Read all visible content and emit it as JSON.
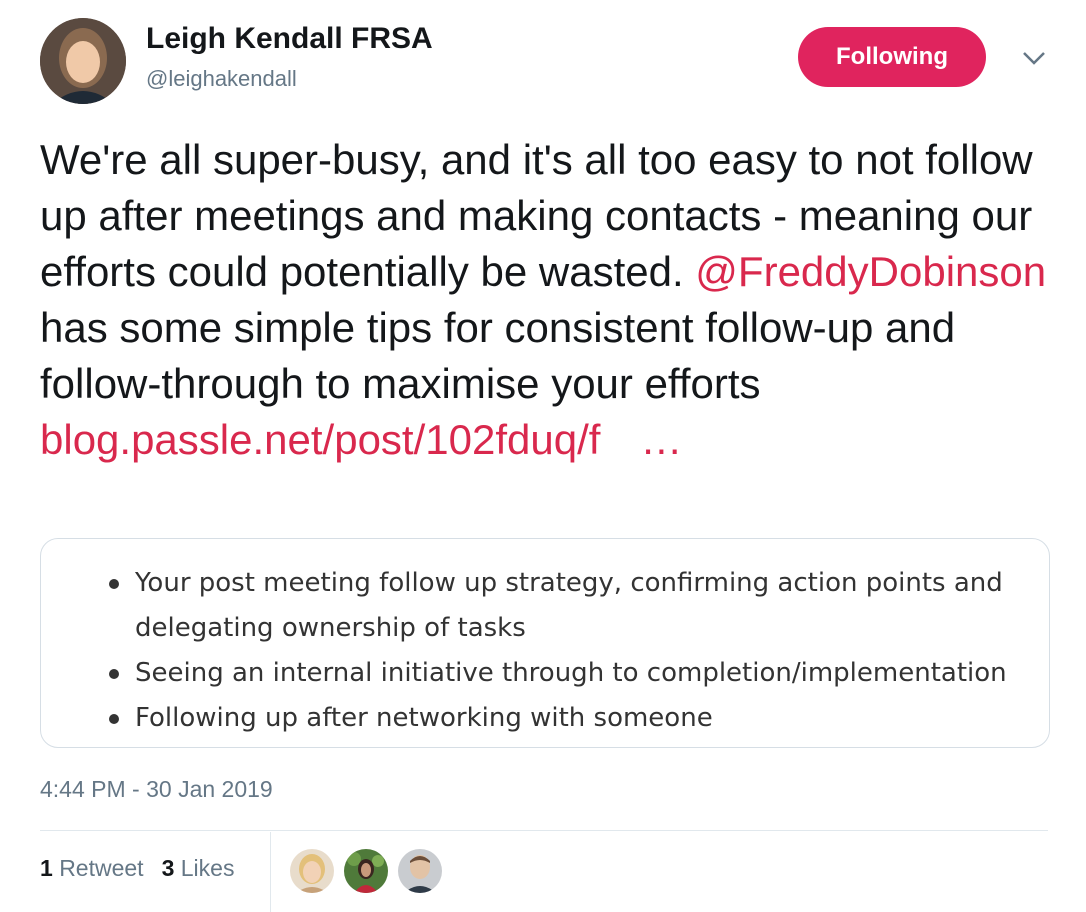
{
  "author": {
    "name": "Leigh Kendall FRSA",
    "handle": "@leighakendall"
  },
  "follow_button_label": "Following",
  "tweet": {
    "text_before": "We're all super-busy, and it's all too easy to not follow up after meetings and making contacts - meaning our efforts could potentially be wasted. ",
    "mention": "@FreddyDobinson",
    "text_after": " has some simple tips for consistent follow-up and follow-through to maximise your efforts ",
    "link": "blog.passle.net/post/102fduq/f",
    "ellipsis": "…"
  },
  "card": {
    "items": [
      "Your post meeting follow up strategy, confirming action points and delegating ownership of tasks",
      "Seeing an internal initiative through to completion/implementation",
      "Following up after networking with someone"
    ]
  },
  "timestamp": "4:44 PM - 30 Jan 2019",
  "stats": {
    "retweets_count": "1",
    "retweets_label": "Retweet",
    "likes_count": "3",
    "likes_label": "Likes"
  },
  "colors": {
    "accent": "#e0245e",
    "link": "#d9284d",
    "muted": "#657786"
  },
  "icons": {
    "caret": "chevron-down-icon"
  }
}
